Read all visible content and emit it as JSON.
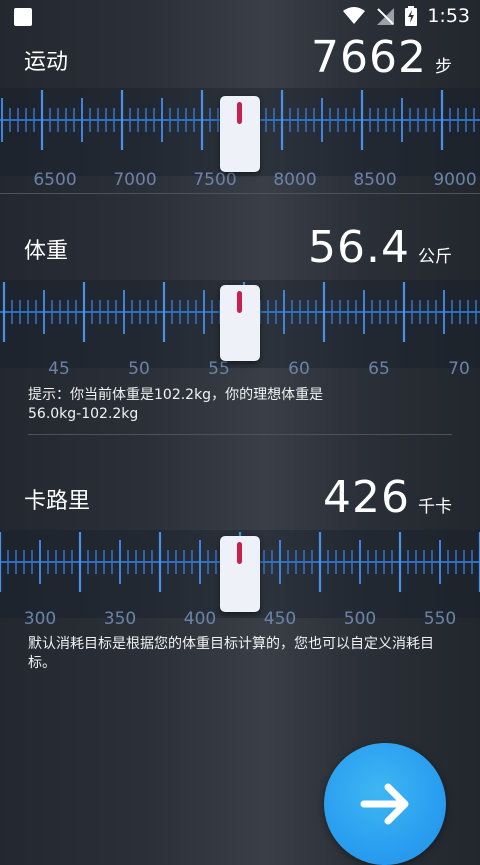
{
  "status_bar": {
    "time": "1:53"
  },
  "sections": [
    {
      "label": "运动",
      "value": "7662",
      "unit": "步",
      "ticks": [
        "6500",
        "7000",
        "7500",
        "8000",
        "8500",
        "9000"
      ]
    },
    {
      "label": "体重",
      "value": "56.4",
      "unit": "公斤",
      "ticks": [
        "45",
        "50",
        "55",
        "60",
        "65",
        "70"
      ],
      "hint": "提示：你当前体重是102.2kg，你的理想体重是56.0kg-102.2kg"
    },
    {
      "label": "卡路里",
      "value": "426",
      "unit": "千卡",
      "ticks": [
        "300",
        "350",
        "400",
        "450",
        "500",
        "550"
      ],
      "hint": "默认消耗目标是根据您的体重目标计算的，您也可以自定义消耗目标。"
    }
  ],
  "next_button": {
    "icon": "arrow-right-icon"
  },
  "colors": {
    "tick_blue": "#3a7fd5",
    "pointer_mark": "#c8204f",
    "next_button": "#2a9ef0"
  }
}
